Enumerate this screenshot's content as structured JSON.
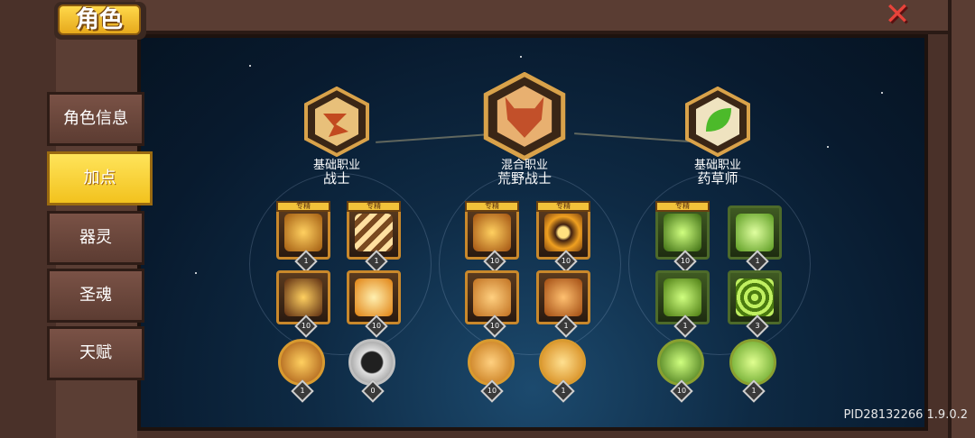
{
  "window": {
    "title": "角色",
    "close_icon": "close-x-icon"
  },
  "sidebar": {
    "items": [
      {
        "label": "角色信息",
        "active": false
      },
      {
        "label": "加点",
        "active": true
      },
      {
        "label": "器灵",
        "active": false
      },
      {
        "label": "圣魂",
        "active": false
      },
      {
        "label": "天赋",
        "active": false
      }
    ]
  },
  "classes": [
    {
      "kind": "基础职业",
      "name": "战士",
      "icon": "sword-slash-icon",
      "color": "#c98a3a"
    },
    {
      "kind": "混合职业",
      "name": "荒野战士",
      "icon": "beast-helmet-icon",
      "color": "#d26a3a"
    },
    {
      "kind": "基础职业",
      "name": "药草师",
      "icon": "leaf-icon",
      "color": "#4cba2a"
    }
  ],
  "skills": {
    "tag_label": "专精",
    "row1": [
      {
        "name": "warrior-slash-skill",
        "level": "1",
        "tag": true,
        "color": "#f0b030"
      },
      {
        "name": "warrior-claw-skill",
        "level": "1",
        "tag": true,
        "color": "#f0c060"
      },
      {
        "name": "wild-fire-skill",
        "level": "10",
        "tag": true,
        "color": "#f0a020"
      },
      {
        "name": "wild-bomb-skill",
        "level": "10",
        "tag": true,
        "color": "#f0b020"
      },
      {
        "name": "herb-totem-skill",
        "level": "10",
        "tag": true,
        "color": "#90e040"
      },
      {
        "name": "herb-burst-skill",
        "level": "1",
        "tag": false,
        "color": "#a0e040"
      }
    ],
    "row2": [
      {
        "name": "warrior-rage-skill",
        "level": "10",
        "color": "#f0a020"
      },
      {
        "name": "warrior-sword-skill",
        "level": "10",
        "color": "#f0b030"
      },
      {
        "name": "wild-leaf-skill",
        "level": "10",
        "color": "#e0a030"
      },
      {
        "name": "wild-mask-skill",
        "level": "1",
        "color": "#e09030"
      },
      {
        "name": "herb-potion-skill",
        "level": "1",
        "color": "#a0e040"
      },
      {
        "name": "herb-spiral-skill",
        "level": "3",
        "color": "#90d040"
      }
    ],
    "row3": [
      {
        "name": "warrior-sword-orb",
        "level": "1",
        "color": "#f0a020"
      },
      {
        "name": "warrior-ghost-orb",
        "level": "0",
        "color": "#d0d0d0"
      },
      {
        "name": "wild-leaf-orb",
        "level": "10",
        "color": "#f0a020"
      },
      {
        "name": "wild-note-orb",
        "level": "1",
        "color": "#f0b030"
      },
      {
        "name": "herb-drop-orb",
        "level": "10",
        "color": "#a0e040"
      },
      {
        "name": "herb-flask-orb",
        "level": "1",
        "color": "#a0e040"
      }
    ]
  },
  "footer": {
    "pid": "PID28132266 1.9.0.2"
  }
}
